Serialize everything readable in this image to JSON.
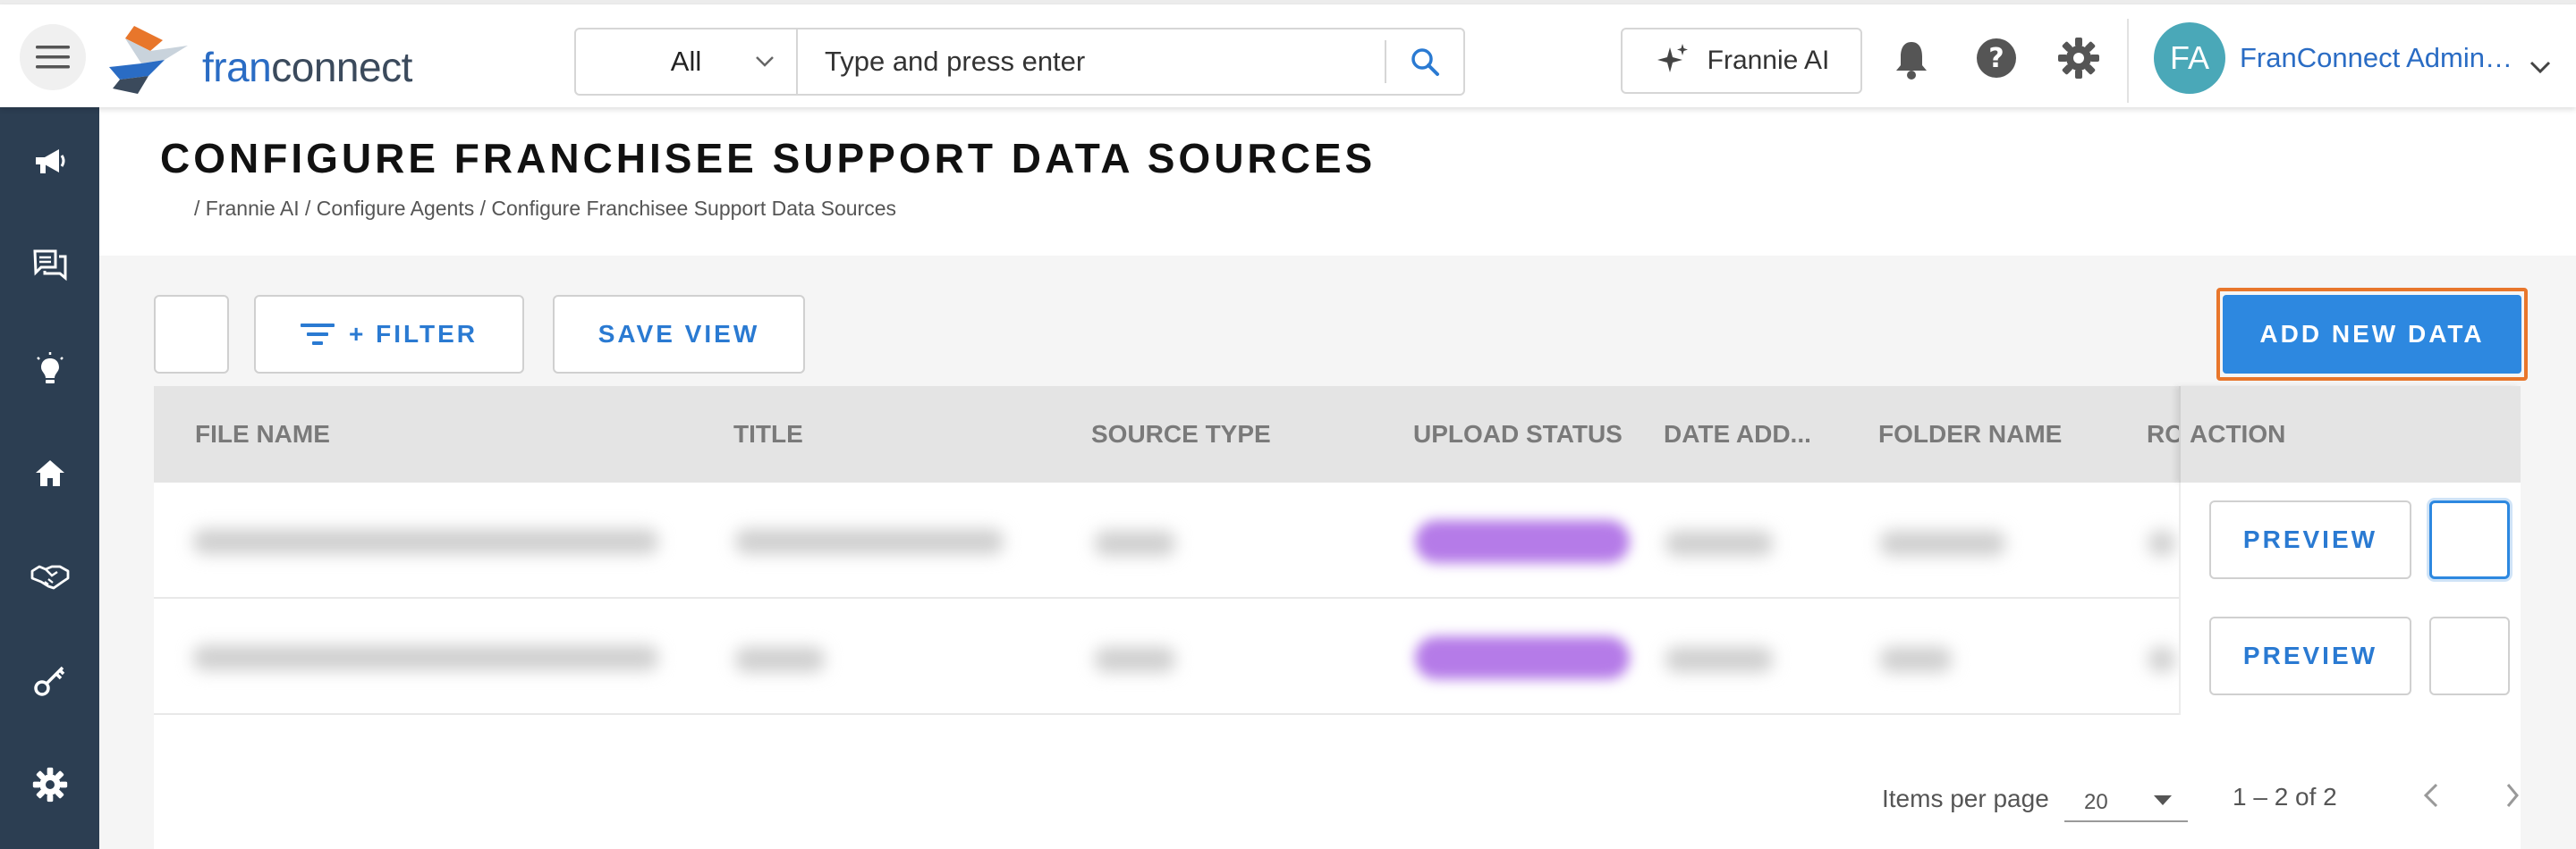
{
  "header": {
    "logo_text_a": "fran",
    "logo_text_b": "connect",
    "search_scope": "All",
    "search_placeholder": "Type and press enter",
    "ai_button_label": "Frannie AI",
    "user_initials": "FA",
    "user_name": "FranConnect Administrator"
  },
  "sidebar": {
    "items": [
      "megaphone-icon",
      "chat-icon",
      "lightbulb-icon",
      "home-icon",
      "handshake-icon",
      "key-icon",
      "gear-icon"
    ],
    "background": "#2c3e52"
  },
  "page": {
    "title": "CONFIGURE FRANCHISEE SUPPORT DATA SOURCES",
    "breadcrumb": "/ Frannie AI / Configure Agents / Configure Franchisee Support Data Sources"
  },
  "toolbar": {
    "filter_label": "+ FILTER",
    "save_view_label": "SAVE VIEW",
    "add_new_label": "ADD NEW DATA"
  },
  "table": {
    "columns": [
      "FILE NAME",
      "TITLE",
      "SOURCE TYPE",
      "UPLOAD STATUS",
      "DATE ADD...",
      "FOLDER NAME",
      "RO",
      "ACTION"
    ],
    "rows": [
      {
        "preview_label": "PREVIEW"
      },
      {
        "preview_label": "PREVIEW"
      }
    ]
  },
  "pagination": {
    "items_per_page_label": "Items per page",
    "items_per_page": "20",
    "range": "1 – 2 of 2"
  },
  "colors": {
    "accent": "#2d88e0",
    "highlight": "#e8762b",
    "status_pill": "#b57be8"
  }
}
